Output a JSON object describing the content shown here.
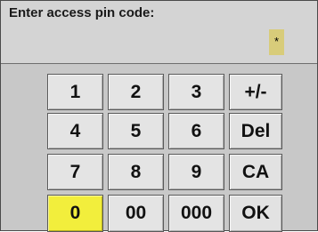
{
  "header": {
    "prompt": "Enter access pin code:",
    "pin_mask": "*"
  },
  "keypad": {
    "keys": [
      [
        "1",
        "2",
        "3",
        "+/-"
      ],
      [
        "4",
        "5",
        "6",
        "Del"
      ],
      [
        "7",
        "8",
        "9",
        "CA"
      ],
      [
        "0",
        "00",
        "000",
        "OK"
      ]
    ],
    "active_key": "0"
  },
  "colors": {
    "active_key": "#f2ee3c",
    "pin_field": "#d8cc7a",
    "background": "#c8c8c8"
  }
}
